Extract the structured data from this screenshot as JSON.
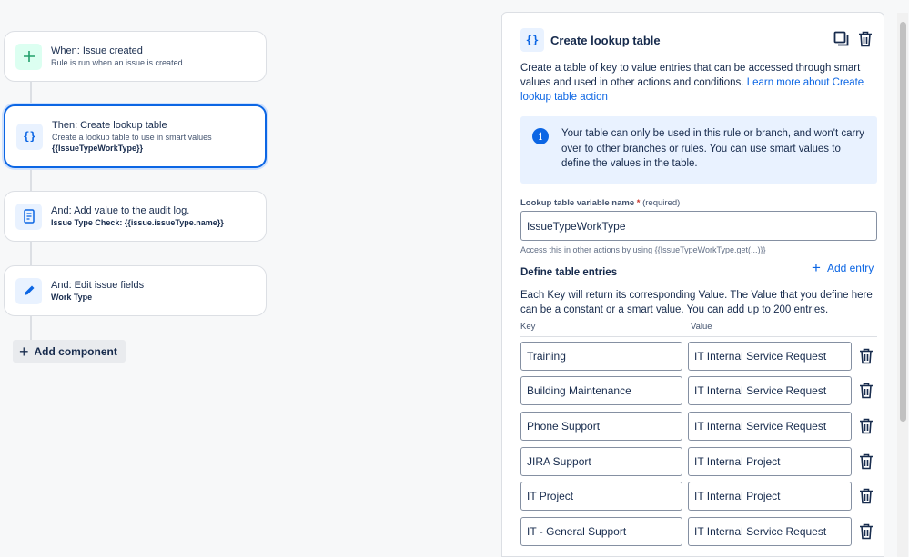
{
  "flow": {
    "trigger": {
      "title": "When: Issue created",
      "subtitle": "Rule is run when an issue is created."
    },
    "lookup": {
      "title": "Then: Create lookup table",
      "subtitle": "Create a lookup table to use in smart values",
      "detail": "{{IssueTypeWorkType}}"
    },
    "audit": {
      "title": "And: Add value to the audit log.",
      "detail": "Issue Type Check: {{issue.issueType.name}}"
    },
    "edit": {
      "title": "And: Edit issue fields",
      "detail": "Work Type"
    },
    "add_component_label": "Add component"
  },
  "panel": {
    "icon_text": "{}",
    "title": "Create lookup table",
    "description": "Create a table of key to value entries that can be accessed through smart values and used in other actions and conditions. ",
    "learn_more": "Learn more about Create lookup table action",
    "info": "Your table can only be used in this rule or branch, and won't carry over to other branches or rules. You can use smart values to define the values in the table.",
    "var_label": "Lookup table variable name",
    "var_required_mark": "*",
    "var_required_text": "(required)",
    "var_value": "IssueTypeWorkType",
    "helper": "Access this in other actions by using {{IssueTypeWorkType.get(...)}}",
    "define_title": "Define table entries",
    "add_entry": "Add entry",
    "define_desc": "Each Key will return its corresponding Value. The Value that you define here can be a constant or a smart value. You can add up to 200 entries.",
    "key_header": "Key",
    "value_header": "Value",
    "entries": [
      {
        "key": "Training",
        "value": "IT Internal Service Request"
      },
      {
        "key": "Building Maintenance",
        "value": "IT Internal Service Request"
      },
      {
        "key": "Phone Support",
        "value": "IT Internal Service Request"
      },
      {
        "key": "JIRA Support",
        "value": "IT Internal Project"
      },
      {
        "key": "IT Project",
        "value": "IT Internal Project"
      },
      {
        "key": "IT - General Support",
        "value": "IT Internal Service Request"
      }
    ]
  },
  "colors": {
    "accent": "#0c66e4",
    "trigger": "#22a06b",
    "selected_border": "#0c66e4"
  }
}
